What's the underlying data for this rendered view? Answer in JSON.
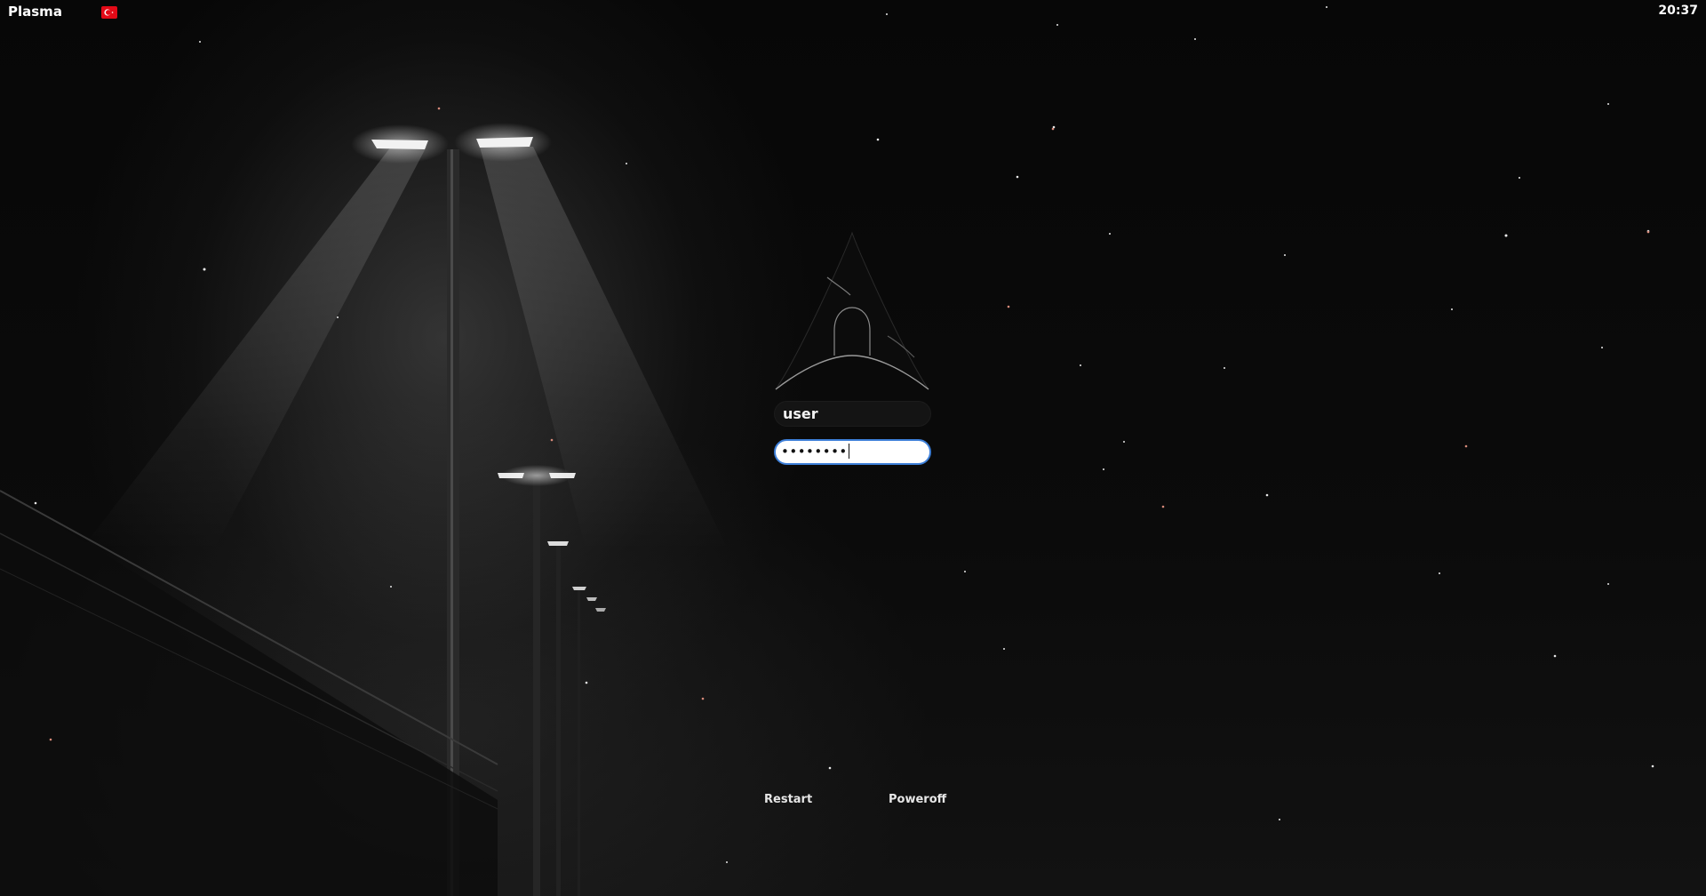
{
  "topbar": {
    "session_label": "Plasma",
    "keyboard_layout_icon": "turkey-flag-icon",
    "clock": "20:37"
  },
  "login": {
    "logo_icon": "arch-linux-logo-icon",
    "username": "user",
    "password_mask": "••••••••",
    "focused_border_color": "#3d7fd8"
  },
  "actions": {
    "restart_label": "Restart",
    "poweroff_label": "Poweroff"
  },
  "colors": {
    "background": "#050505",
    "flag_red": "#e30a17"
  }
}
